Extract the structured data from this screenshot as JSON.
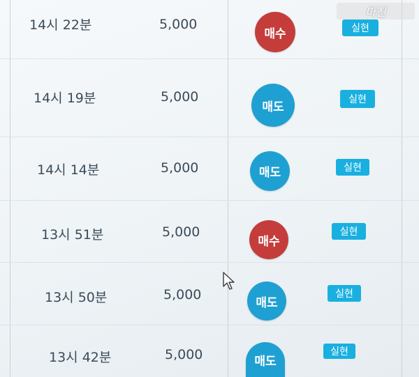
{
  "rows": [
    {
      "time": "14시 22분",
      "amount": "5,000",
      "type": "매수",
      "action": "실현"
    },
    {
      "time": "14시 19분",
      "amount": "5,000",
      "type": "매도",
      "action": "실현"
    },
    {
      "time": "14시 14분",
      "amount": "5,000",
      "type": "매도",
      "action": "실현"
    },
    {
      "time": "13시 51분",
      "amount": "5,000",
      "type": "매수",
      "action": "실현"
    },
    {
      "time": "13시 50분",
      "amount": "5,000",
      "type": "매도",
      "action": "실현"
    },
    {
      "time": "13시 42분",
      "amount": "5,000",
      "type": "매도",
      "action": "실현"
    }
  ],
  "watermark": "마진",
  "colors": {
    "buy": "#c43d3b",
    "sell": "#1fa0d2",
    "action": "#19b0e0",
    "text": "#3c4b58"
  }
}
